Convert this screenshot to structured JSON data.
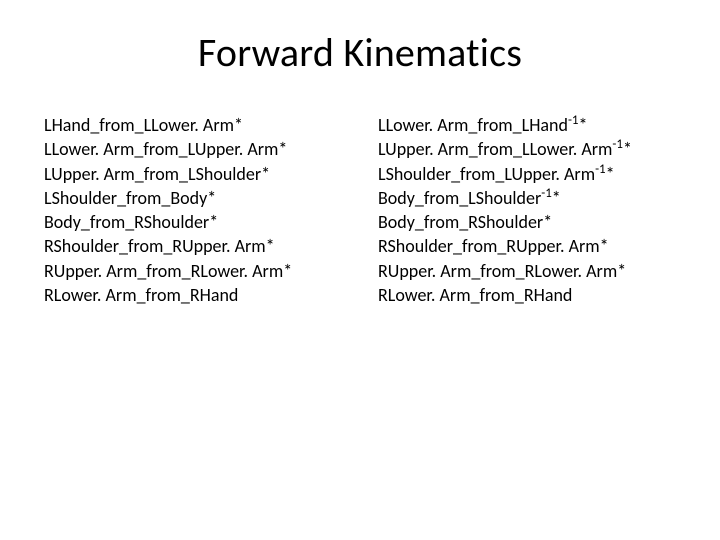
{
  "title": "Forward Kinematics",
  "left_column": [
    {
      "text": "LHand_from_LLower. Arm*"
    },
    {
      "text": "LLower. Arm_from_LUpper. Arm*"
    },
    {
      "text": "LUpper. Arm_from_LShoulder*"
    },
    {
      "text": "LShoulder_from_Body*"
    },
    {
      "text": "Body_from_RShoulder*"
    },
    {
      "text": "RShoulder_from_RUpper. Arm*"
    },
    {
      "text": "RUpper. Arm_from_RLower. Arm*"
    },
    {
      "text": "RLower. Arm_from_RHand"
    }
  ],
  "right_column": [
    {
      "text": "LLower. Arm_from_LHand",
      "sup": "-1",
      "tail": "*"
    },
    {
      "text": "LUpper. Arm_from_LLower. Arm",
      "sup": "-1",
      "tail": "*"
    },
    {
      "text": "LShoulder_from_LUpper. Arm",
      "sup": "-1",
      "tail": "*"
    },
    {
      "text": "Body_from_LShoulder",
      "sup": "-1",
      "tail": "*"
    },
    {
      "text": "Body_from_RShoulder*"
    },
    {
      "text": "RShoulder_from_RUpper. Arm*"
    },
    {
      "text": "RUpper. Arm_from_RLower. Arm*"
    },
    {
      "text": "RLower. Arm_from_RHand"
    }
  ]
}
